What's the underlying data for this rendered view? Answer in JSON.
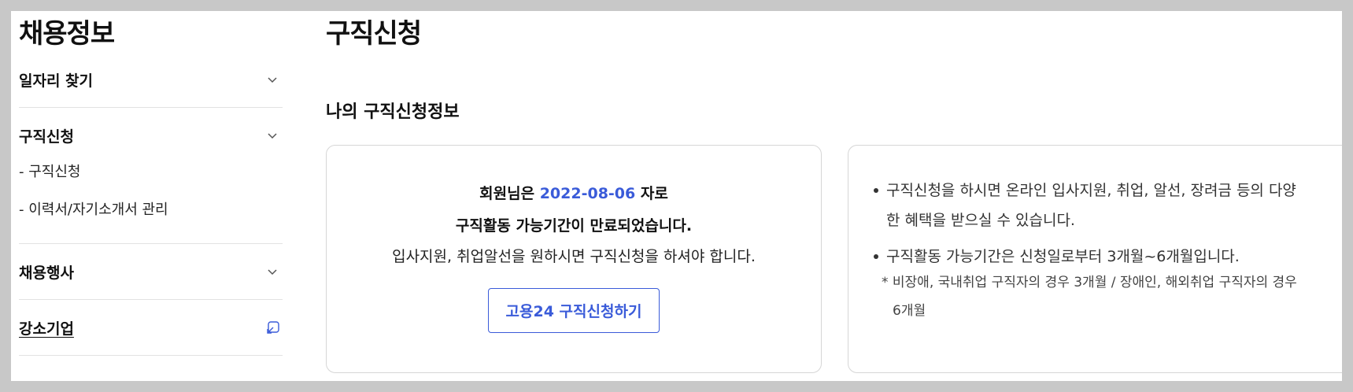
{
  "sidebar": {
    "title": "채용정보",
    "groups": [
      {
        "label": "일자리 찾기"
      },
      {
        "label": "구직신청",
        "items": [
          "- 구직신청",
          "- 이력서/자기소개서 관리"
        ]
      },
      {
        "label": "채용행사"
      },
      {
        "label": "강소기업"
      }
    ]
  },
  "main": {
    "page_title": "구직신청",
    "section_title": "나의 구직신청정보",
    "status": {
      "prefix": "회원님은",
      "date": "2022-08-06",
      "suffix": "자로",
      "expired": "구직활동 가능기간이 만료되었습니다.",
      "instruction": "입사지원, 취업알선을 원하시면 구직신청을 하셔야 합니다.",
      "button_label": "고용24 구직신청하기"
    },
    "info": {
      "bullet1_a": "구직신청을 하시면 온라인 입사지원, 취업, 알선, 장려금 등의 다양",
      "bullet1_b": "한 혜택을 받으실 수 있습니다.",
      "bullet2": "구직활동 가능기간은 신청일로부터 3개월~6개월입니다.",
      "note_a": "* 비장애, 국내취업 구직자의 경우 3개월 / 장애인, 해외취업 구직자의 경우",
      "note_b": "6개월"
    }
  },
  "colors": {
    "accent": "#3a5bd9",
    "backdrop": "#c8c8c8"
  },
  "icons": {
    "chevron": "chevron-down-icon",
    "external": "external-link-icon"
  }
}
